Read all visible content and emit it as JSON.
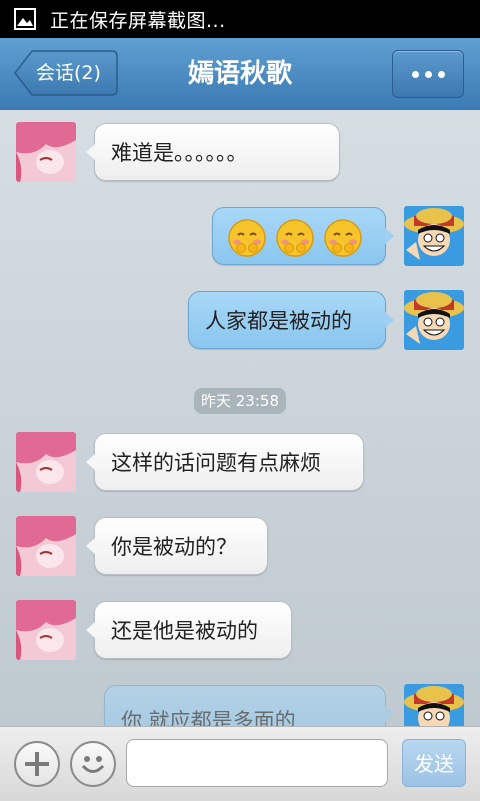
{
  "statusbar": {
    "text": "正在保存屏幕截图..."
  },
  "titlebar": {
    "back_label": "会话(2)",
    "title": "嫣语秋歌"
  },
  "messages": {
    "m1": "难道是。。。。。。",
    "m3": "人家都是被动的",
    "timestamp": "昨天 23:58",
    "m4": "这样的话问题有点麻烦",
    "m5": "你是被动的？",
    "m6": "还是他是被动的",
    "m7_partial": "你 就应都是多面的"
  },
  "inputbar": {
    "placeholder": "",
    "send_label": "发送"
  },
  "colors": {
    "header": "#4a8cc4",
    "bubble_right": "#9fd2f4",
    "bubble_left": "#ffffff"
  }
}
